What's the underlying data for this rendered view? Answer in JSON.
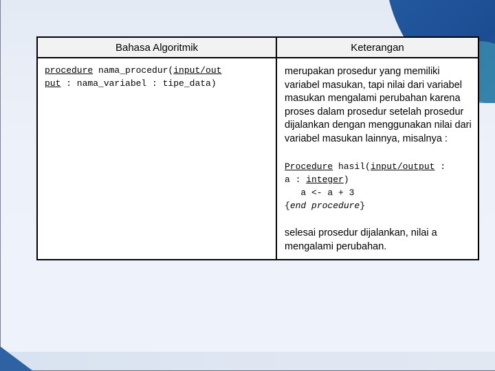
{
  "slide": {
    "table": {
      "headers": [
        "Bahasa Algoritmik",
        "Keterangan"
      ],
      "algorithm": {
        "keyword_procedure": "procedure",
        "name": " nama_procedur(",
        "keyword_inout_1": "input/out",
        "keyword_inout_2": "put",
        "rest": " : nama_variabel : tipe_data)"
      },
      "description": {
        "intro": "merupakan prosedur yang memiliki variabel masukan, tapi nilai dari variabel masukan mengalami perubahan karena proses dalam prosedur setelah prosedur dijalankan dengan menggunakan nilai dari variabel masukan lainnya, misalnya :",
        "example": {
          "kw_procedure": "Procedure",
          "name": " hasil(",
          "kw_inout": "input/output",
          "after_inout": " :",
          "line2_a": "a : ",
          "kw_integer": "integer",
          "line2_end": ")",
          "line3": "   a <- a + 3",
          "line4_open": "{",
          "line4_text": "end procedure",
          "line4_close": "}"
        },
        "conclusion": "selesai prosedur dijalankan, nilai a mengalami perubahan."
      }
    }
  }
}
